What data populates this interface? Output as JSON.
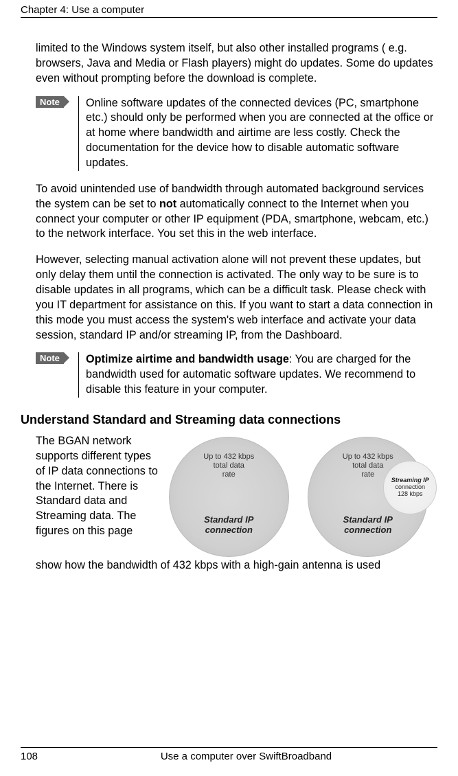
{
  "header": {
    "chapter_line": "Chapter 4:  Use a computer"
  },
  "body": {
    "para1": "limited to the Windows system itself, but also other installed programs ( e.g. browsers, Java and Media or Flash players) might do updates. Some do updates even without prompting before the download is complete.",
    "note1": {
      "tag": "Note",
      "text": "Online software updates of the connected devices (PC, smartphone etc.) should only be performed when you are connected at the office or at home where bandwidth and airtime are less costly. Check the documentation for the device how to disable automatic software updates."
    },
    "para2a": "To avoid unintended use of bandwidth through automated background services the system can be set to ",
    "para2bold": "not",
    "para2b": " automatically connect to the Internet when you connect your computer or other IP equipment (PDA, smartphone, webcam, etc.) to the network interface. You set this in the web interface.",
    "para3": "However, selecting manual activation alone will not prevent these updates, but only delay them until the connection is activated. The only way to be sure is to disable updates in all programs, which can be a difficult task. Please check with you IT department for assistance on this. If you want to start a data connection in this mode you must access the system's web interface and activate your data session, standard IP and/or streaming IP, from the Dashboard.",
    "note2": {
      "tag": "Note",
      "bold": "Optimize airtime and bandwidth usage",
      "text": ": You are charged for the bandwidth used for automatic software updates. We recommend to disable this feature in your computer."
    },
    "section_heading": "Understand Standard and Streaming data connections",
    "fig_para_left": "The BGAN network supports different types of IP data connections to the Internet. There is Standard data and Streaming data. The figures on this page",
    "fig_para_after": "show how the bandwidth of 432 kbps with a high-gain antenna is used"
  },
  "figures": {
    "left": {
      "top1": "Up to 432 kbps",
      "top2": "total data",
      "top3": "rate",
      "bottom1": "Standard IP",
      "bottom2": "connection"
    },
    "right": {
      "top1": "Up to 432 kbps",
      "top2": "total data",
      "top3": "rate",
      "bottom1": "Standard IP",
      "bottom2": "connection",
      "small": {
        "title": "Streaming IP",
        "l2": "connection",
        "l3": "128 kbps"
      }
    }
  },
  "footer": {
    "page": "108",
    "text": "Use a computer over SwiftBroadband"
  }
}
